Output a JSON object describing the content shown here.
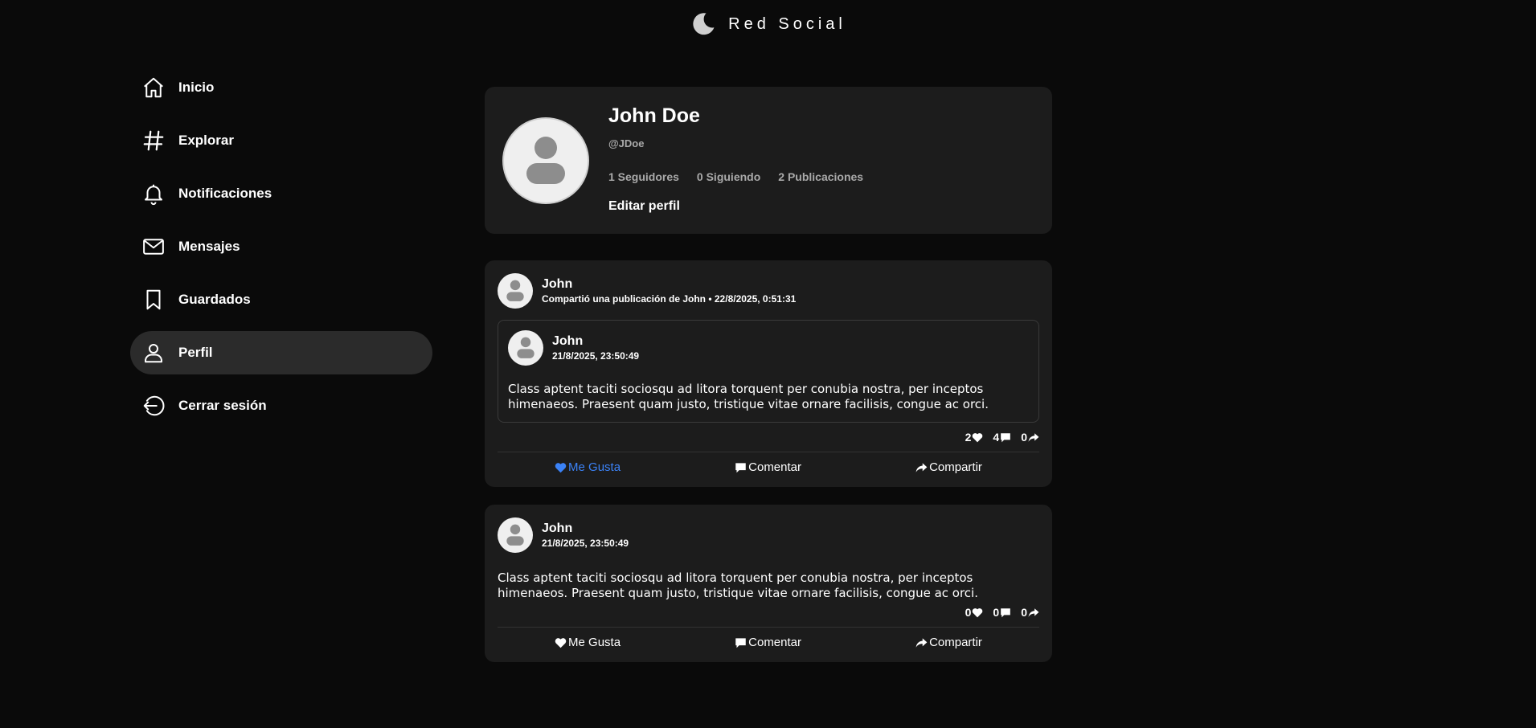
{
  "app": {
    "title": "Red Social"
  },
  "sidebar": {
    "items": [
      {
        "label": "Inicio",
        "icon": "home-icon"
      },
      {
        "label": "Explorar",
        "icon": "hash-icon"
      },
      {
        "label": "Notificaciones",
        "icon": "bell-icon"
      },
      {
        "label": "Mensajes",
        "icon": "mail-icon"
      },
      {
        "label": "Guardados",
        "icon": "bookmark-icon"
      },
      {
        "label": "Perfil",
        "icon": "user-icon",
        "active": true
      },
      {
        "label": "Cerrar sesión",
        "icon": "logout-icon"
      }
    ]
  },
  "profile": {
    "name": "John Doe",
    "handle": "@JDoe",
    "followers": "1 Seguidores",
    "following": "0 Siguiendo",
    "posts": "2 Publicaciones",
    "edit_label": "Editar perfil"
  },
  "posts": [
    {
      "author": "John",
      "subtitle": "Compartió una publicación de John • 22/8/2025, 0:51:31",
      "shared": {
        "author": "John",
        "date": "21/8/2025, 23:50:49",
        "text": "Class aptent taciti sociosqu ad litora torquent per conubia nostra, per inceptos himenaeos. Praesent quam justo, tristique vitae ornare facilisis, congue ac orci."
      },
      "likes": "2",
      "comments": "4",
      "shares": "0",
      "liked": true
    },
    {
      "author": "John",
      "subtitle": "21/8/2025, 23:50:49",
      "text": "Class aptent taciti sociosqu ad litora torquent per conubia nostra, per inceptos himenaeos. Praesent quam justo, tristique vitae ornare facilisis, congue ac orci.",
      "likes": "0",
      "comments": "0",
      "shares": "0",
      "liked": false
    }
  ],
  "actions": {
    "like": "Me Gusta",
    "comment": "Comentar",
    "share": "Compartir"
  },
  "colors": {
    "background": "#0a0a0a",
    "card": "#1c1c1c",
    "accent": "#3b82f6",
    "active_nav": "#2b2b2b"
  }
}
